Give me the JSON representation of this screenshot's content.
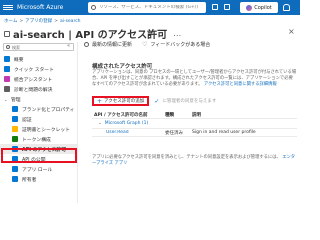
{
  "topbar": {
    "brand": "Microsoft Azure",
    "search_placeholder": "リソース、サービス、ドキュメントの検索 (G+/)",
    "copilot_label": "Copilot"
  },
  "breadcrumb": [
    "ホーム",
    "アプリの登録",
    "ai-search"
  ],
  "page": {
    "title": "ai-search | API のアクセス許可",
    "more": "…",
    "close": "×"
  },
  "toolbar": {
    "refresh_label": "最新の情報に更新",
    "feedback_label": "フィードバックがある場合"
  },
  "sidebar": {
    "search_placeholder": "検索",
    "collapse": "«",
    "items": [
      {
        "label": "概要",
        "level": "top",
        "icon_color": "#0078d4",
        "icon": "overview-icon"
      },
      {
        "label": "クイック スタート",
        "level": "top",
        "icon_color": "#0078d4",
        "icon": "quickstart-icon"
      },
      {
        "label": "統合アシスタント",
        "level": "top",
        "icon_color": "#c239b3",
        "icon": "integration-icon"
      },
      {
        "label": "診断と問題の解決",
        "level": "top",
        "icon_color": "#605e5c",
        "icon": "diagnose-icon"
      },
      {
        "label": "管理",
        "level": "group",
        "icon_color": "",
        "icon": "chevron-down-icon"
      },
      {
        "label": "ブランド化とプロパティ",
        "level": "sub",
        "icon_color": "#0078d4",
        "icon": "branding-icon"
      },
      {
        "label": "認証",
        "level": "sub",
        "icon_color": "#0078d4",
        "icon": "authentication-icon"
      },
      {
        "label": "証明書とシークレット",
        "level": "sub",
        "icon_color": "#ffb900",
        "icon": "certificate-icon"
      },
      {
        "label": "トークン構成",
        "level": "sub",
        "icon_color": "#107c10",
        "icon": "token-icon"
      },
      {
        "label": "API のアクセス許可",
        "level": "sub-active",
        "icon_color": "#0078d4",
        "icon": "api-permissions-icon"
      },
      {
        "label": "API の公開",
        "level": "sub",
        "icon_color": "#0078d4",
        "icon": "expose-api-icon"
      },
      {
        "label": "アプリ ロール",
        "level": "sub",
        "icon_color": "#0078d4",
        "icon": "app-roles-icon"
      },
      {
        "label": "所有者",
        "level": "sub",
        "icon_color": "#0078d4",
        "icon": "owners-icon"
      }
    ]
  },
  "main": {
    "section_title": "構成されたアクセス許可",
    "desc_text": "アプリケーションは、同意の プロセスの一環としてユーザー/管理者からアクセス許可が付与されている場合、API を呼び出すことが承認されます。構成されたアクセス許可の一覧には、アプリケーションで必要なすべてのアクセス許可が含まれている必要があります。",
    "desc_link": "アクセス許可と同意に関する詳細情報",
    "add_permission_label": "アクセス許可の追加",
    "grant_label": "に管理者の同意を与えます",
    "table": {
      "headers": [
        "API / アクセス許可の名前",
        "種類",
        "説明"
      ],
      "group": "Microsoft Graph (1)",
      "rows": [
        {
          "name": "User.Read",
          "type": "委任済み",
          "desc": "Sign in and read user profile"
        }
      ]
    },
    "footer_text": "アプリに必要なアクセス許可を同意を済みとし、テナントの同意設定を表示および管理するには、",
    "footer_link": "エンタープライズ アプリ"
  }
}
